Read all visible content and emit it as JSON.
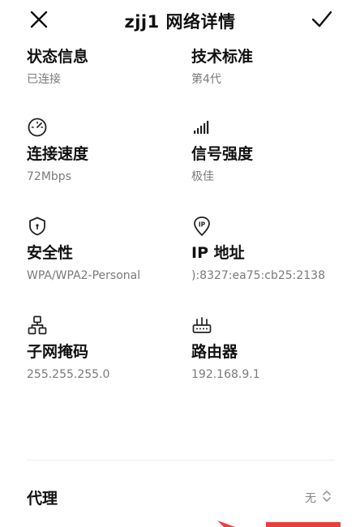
{
  "header": {
    "title": "zjj1 网络详情",
    "close_icon": "close-icon",
    "confirm_icon": "check-icon"
  },
  "details": {
    "status": {
      "label": "状态信息",
      "value": "已连接"
    },
    "standard": {
      "label": "技术标准",
      "value": "第4代"
    },
    "speed": {
      "label": "连接速度",
      "value": "72Mbps",
      "icon": "speedometer-icon"
    },
    "signal": {
      "label": "信号强度",
      "value": "极佳",
      "icon": "signal-bars-icon"
    },
    "security": {
      "label": "安全性",
      "value": "WPA/WPA2-Personal",
      "icon": "shield-icon"
    },
    "ip": {
      "label": "IP 地址",
      "value": "):8327:ea75:cb25:2138",
      "icon": "ip-location-icon"
    },
    "subnet": {
      "label": "子网掩码",
      "value": "255.255.255.0",
      "icon": "network-topology-icon"
    },
    "router": {
      "label": "路由器",
      "value": "192.168.9.1",
      "icon": "router-icon"
    }
  },
  "proxy": {
    "label": "代理",
    "value": "无",
    "icon": "up-down-chevron-icon"
  },
  "colors": {
    "text_primary": "#111111",
    "text_secondary": "#7a7a7a",
    "accent_bottom": "#e54040"
  }
}
